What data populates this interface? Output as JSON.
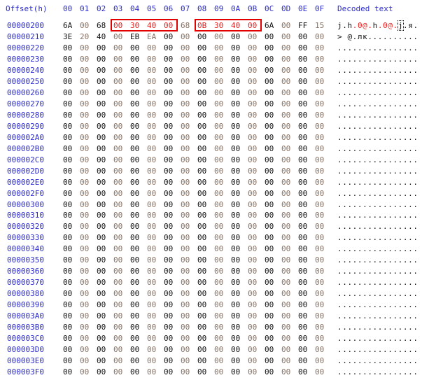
{
  "header": {
    "offset_label": "Offset(h)",
    "columns": [
      "00",
      "01",
      "02",
      "03",
      "04",
      "05",
      "06",
      "07",
      "08",
      "09",
      "0A",
      "0B",
      "0C",
      "0D",
      "0E",
      "0F"
    ],
    "decoded_label": "Decoded text"
  },
  "colors": {
    "offset": "#2a2ad0",
    "even_byte": "#111111",
    "odd_byte": "#8a7060",
    "highlight": "#e82020",
    "box": "#e00000"
  },
  "highlight": {
    "row": 0,
    "ranges": [
      [
        3,
        6
      ],
      [
        8,
        11
      ]
    ],
    "cursor_char": 12
  },
  "rows": [
    {
      "offset": "00000200",
      "bytes": "6A 00 68 00 30 40 00 68 0B 30 40 00 6A 00 FF 15",
      "decoded": "j.h.0@.h.0@.j.я."
    },
    {
      "offset": "00000210",
      "bytes": "3E 20 40 00 EB EA 00 00 00 00 00 00 00 00 00 00",
      "decoded": "> @.лк.........."
    },
    {
      "offset": "00000220",
      "bytes": "00 00 00 00 00 00 00 00 00 00 00 00 00 00 00 00",
      "decoded": "................"
    },
    {
      "offset": "00000230",
      "bytes": "00 00 00 00 00 00 00 00 00 00 00 00 00 00 00 00",
      "decoded": "................"
    },
    {
      "offset": "00000240",
      "bytes": "00 00 00 00 00 00 00 00 00 00 00 00 00 00 00 00",
      "decoded": "................"
    },
    {
      "offset": "00000250",
      "bytes": "00 00 00 00 00 00 00 00 00 00 00 00 00 00 00 00",
      "decoded": "................"
    },
    {
      "offset": "00000260",
      "bytes": "00 00 00 00 00 00 00 00 00 00 00 00 00 00 00 00",
      "decoded": "................"
    },
    {
      "offset": "00000270",
      "bytes": "00 00 00 00 00 00 00 00 00 00 00 00 00 00 00 00",
      "decoded": "................"
    },
    {
      "offset": "00000280",
      "bytes": "00 00 00 00 00 00 00 00 00 00 00 00 00 00 00 00",
      "decoded": "................"
    },
    {
      "offset": "00000290",
      "bytes": "00 00 00 00 00 00 00 00 00 00 00 00 00 00 00 00",
      "decoded": "................"
    },
    {
      "offset": "000002A0",
      "bytes": "00 00 00 00 00 00 00 00 00 00 00 00 00 00 00 00",
      "decoded": "................"
    },
    {
      "offset": "000002B0",
      "bytes": "00 00 00 00 00 00 00 00 00 00 00 00 00 00 00 00",
      "decoded": "................"
    },
    {
      "offset": "000002C0",
      "bytes": "00 00 00 00 00 00 00 00 00 00 00 00 00 00 00 00",
      "decoded": "................"
    },
    {
      "offset": "000002D0",
      "bytes": "00 00 00 00 00 00 00 00 00 00 00 00 00 00 00 00",
      "decoded": "................"
    },
    {
      "offset": "000002E0",
      "bytes": "00 00 00 00 00 00 00 00 00 00 00 00 00 00 00 00",
      "decoded": "................"
    },
    {
      "offset": "000002F0",
      "bytes": "00 00 00 00 00 00 00 00 00 00 00 00 00 00 00 00",
      "decoded": "................"
    },
    {
      "offset": "00000300",
      "bytes": "00 00 00 00 00 00 00 00 00 00 00 00 00 00 00 00",
      "decoded": "................"
    },
    {
      "offset": "00000310",
      "bytes": "00 00 00 00 00 00 00 00 00 00 00 00 00 00 00 00",
      "decoded": "................"
    },
    {
      "offset": "00000320",
      "bytes": "00 00 00 00 00 00 00 00 00 00 00 00 00 00 00 00",
      "decoded": "................"
    },
    {
      "offset": "00000330",
      "bytes": "00 00 00 00 00 00 00 00 00 00 00 00 00 00 00 00",
      "decoded": "................"
    },
    {
      "offset": "00000340",
      "bytes": "00 00 00 00 00 00 00 00 00 00 00 00 00 00 00 00",
      "decoded": "................"
    },
    {
      "offset": "00000350",
      "bytes": "00 00 00 00 00 00 00 00 00 00 00 00 00 00 00 00",
      "decoded": "................"
    },
    {
      "offset": "00000360",
      "bytes": "00 00 00 00 00 00 00 00 00 00 00 00 00 00 00 00",
      "decoded": "................"
    },
    {
      "offset": "00000370",
      "bytes": "00 00 00 00 00 00 00 00 00 00 00 00 00 00 00 00",
      "decoded": "................"
    },
    {
      "offset": "00000380",
      "bytes": "00 00 00 00 00 00 00 00 00 00 00 00 00 00 00 00",
      "decoded": "................"
    },
    {
      "offset": "00000390",
      "bytes": "00 00 00 00 00 00 00 00 00 00 00 00 00 00 00 00",
      "decoded": "................"
    },
    {
      "offset": "000003A0",
      "bytes": "00 00 00 00 00 00 00 00 00 00 00 00 00 00 00 00",
      "decoded": "................"
    },
    {
      "offset": "000003B0",
      "bytes": "00 00 00 00 00 00 00 00 00 00 00 00 00 00 00 00",
      "decoded": "................"
    },
    {
      "offset": "000003C0",
      "bytes": "00 00 00 00 00 00 00 00 00 00 00 00 00 00 00 00",
      "decoded": "................"
    },
    {
      "offset": "000003D0",
      "bytes": "00 00 00 00 00 00 00 00 00 00 00 00 00 00 00 00",
      "decoded": "................"
    },
    {
      "offset": "000003E0",
      "bytes": "00 00 00 00 00 00 00 00 00 00 00 00 00 00 00 00",
      "decoded": "................"
    },
    {
      "offset": "000003F0",
      "bytes": "00 00 00 00 00 00 00 00 00 00 00 00 00 00 00 00",
      "decoded": "................"
    }
  ]
}
